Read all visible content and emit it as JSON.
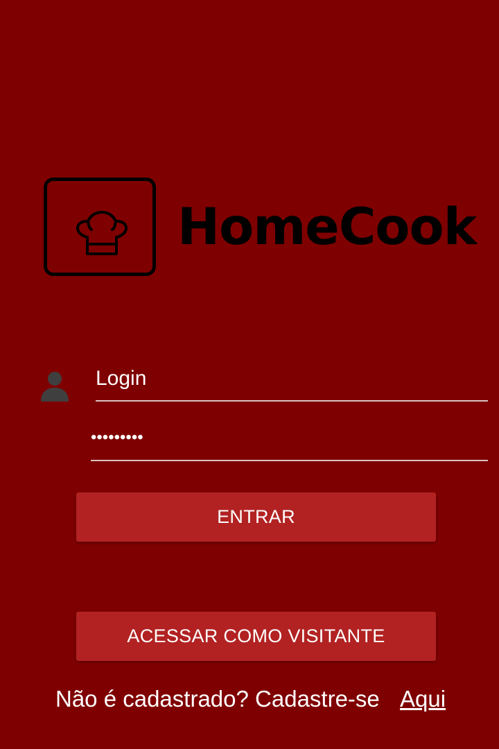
{
  "brand": {
    "name": "HomeCook",
    "logo_icon": "chef-hat-icon"
  },
  "colors": {
    "background": "#7f0000",
    "button": "#b22222",
    "text": "#ffffff",
    "logo": "#000000"
  },
  "form": {
    "login": {
      "value": "Login",
      "icon": "user-icon"
    },
    "password": {
      "value": "•••••••••"
    },
    "submit_label": "ENTRAR",
    "guest_label": "ACESSAR COMO VISITANTE"
  },
  "signup": {
    "text": "Não é cadastrado? Cadastre-se",
    "link_label": "Aqui"
  }
}
